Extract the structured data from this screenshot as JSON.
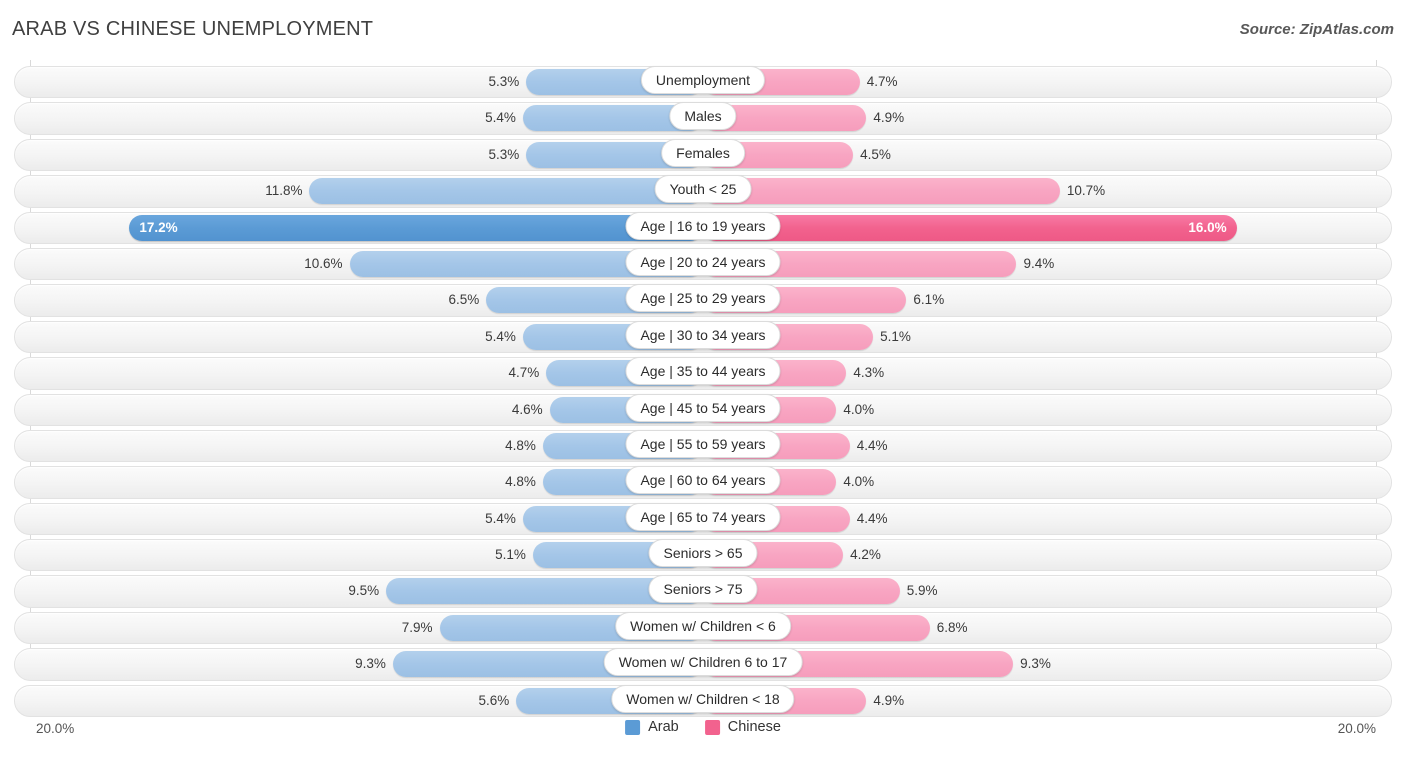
{
  "header": {
    "title": "ARAB VS CHINESE UNEMPLOYMENT",
    "source": "Source: ZipAtlas.com"
  },
  "footer": {
    "axis_min": "20.0%",
    "axis_max": "20.0%",
    "legend": [
      {
        "label": "Arab",
        "color": "#5b9bd5"
      },
      {
        "label": "Chinese",
        "color": "#f2628e"
      }
    ]
  },
  "colors": {
    "arab_normal": "#a4c6e8",
    "arab_highlight": "#5b9bd5",
    "chinese_normal": "#f8a5c2",
    "chinese_highlight": "#f2628e",
    "track": "#f4f4f4",
    "title_text": "#404040"
  },
  "chart_data": {
    "type": "bar",
    "title": "ARAB VS CHINESE UNEMPLOYMENT",
    "subtitle": "",
    "orientation": "horizontal-diverging",
    "xlabel": "",
    "ylabel": "",
    "axis_max": 20.0,
    "axis_unit": "%",
    "grid": false,
    "legend_position": "bottom-center",
    "categories": [
      "Unemployment",
      "Males",
      "Females",
      "Youth < 25",
      "Age | 16 to 19 years",
      "Age | 20 to 24 years",
      "Age | 25 to 29 years",
      "Age | 30 to 34 years",
      "Age | 35 to 44 years",
      "Age | 45 to 54 years",
      "Age | 55 to 59 years",
      "Age | 60 to 64 years",
      "Age | 65 to 74 years",
      "Seniors > 65",
      "Seniors > 75",
      "Women w/ Children < 6",
      "Women w/ Children 6 to 17",
      "Women w/ Children < 18"
    ],
    "series": [
      {
        "name": "Arab",
        "color": "#a4c6e8",
        "values": [
          5.3,
          5.4,
          5.3,
          11.8,
          17.2,
          10.6,
          6.5,
          5.4,
          4.7,
          4.6,
          4.8,
          4.8,
          5.4,
          5.1,
          9.5,
          7.9,
          9.3,
          5.6
        ]
      },
      {
        "name": "Chinese",
        "color": "#f8a5c2",
        "values": [
          4.7,
          4.9,
          4.5,
          10.7,
          16.0,
          9.4,
          6.1,
          5.1,
          4.3,
          4.0,
          4.4,
          4.0,
          4.4,
          4.2,
          5.9,
          6.8,
          9.3,
          4.9
        ]
      }
    ],
    "highlighted_category": "Age | 16 to 19 years"
  },
  "rows": [
    {
      "label": "Unemployment",
      "left": "5.3%",
      "right": "4.7%",
      "left_val": 5.3,
      "right_val": 4.7,
      "highlight": false
    },
    {
      "label": "Males",
      "left": "5.4%",
      "right": "4.9%",
      "left_val": 5.4,
      "right_val": 4.9,
      "highlight": false
    },
    {
      "label": "Females",
      "left": "5.3%",
      "right": "4.5%",
      "left_val": 5.3,
      "right_val": 4.5,
      "highlight": false
    },
    {
      "label": "Youth < 25",
      "left": "11.8%",
      "right": "10.7%",
      "left_val": 11.8,
      "right_val": 10.7,
      "highlight": false
    },
    {
      "label": "Age | 16 to 19 years",
      "left": "17.2%",
      "right": "16.0%",
      "left_val": 17.2,
      "right_val": 16.0,
      "highlight": true
    },
    {
      "label": "Age | 20 to 24 years",
      "left": "10.6%",
      "right": "9.4%",
      "left_val": 10.6,
      "right_val": 9.4,
      "highlight": false
    },
    {
      "label": "Age | 25 to 29 years",
      "left": "6.5%",
      "right": "6.1%",
      "left_val": 6.5,
      "right_val": 6.1,
      "highlight": false
    },
    {
      "label": "Age | 30 to 34 years",
      "left": "5.4%",
      "right": "5.1%",
      "left_val": 5.4,
      "right_val": 5.1,
      "highlight": false
    },
    {
      "label": "Age | 35 to 44 years",
      "left": "4.7%",
      "right": "4.3%",
      "left_val": 4.7,
      "right_val": 4.3,
      "highlight": false
    },
    {
      "label": "Age | 45 to 54 years",
      "left": "4.6%",
      "right": "4.0%",
      "left_val": 4.6,
      "right_val": 4.0,
      "highlight": false
    },
    {
      "label": "Age | 55 to 59 years",
      "left": "4.8%",
      "right": "4.4%",
      "left_val": 4.8,
      "right_val": 4.4,
      "highlight": false
    },
    {
      "label": "Age | 60 to 64 years",
      "left": "4.8%",
      "right": "4.0%",
      "left_val": 4.8,
      "right_val": 4.0,
      "highlight": false
    },
    {
      "label": "Age | 65 to 74 years",
      "left": "5.4%",
      "right": "4.4%",
      "left_val": 5.4,
      "right_val": 4.4,
      "highlight": false
    },
    {
      "label": "Seniors > 65",
      "left": "5.1%",
      "right": "4.2%",
      "left_val": 5.1,
      "right_val": 4.2,
      "highlight": false
    },
    {
      "label": "Seniors > 75",
      "left": "9.5%",
      "right": "5.9%",
      "left_val": 9.5,
      "right_val": 5.9,
      "highlight": false
    },
    {
      "label": "Women w/ Children < 6",
      "left": "7.9%",
      "right": "6.8%",
      "left_val": 7.9,
      "right_val": 6.8,
      "highlight": false
    },
    {
      "label": "Women w/ Children 6 to 17",
      "left": "9.3%",
      "right": "9.3%",
      "left_val": 9.3,
      "right_val": 9.3,
      "highlight": false
    },
    {
      "label": "Women w/ Children < 18",
      "left": "5.6%",
      "right": "4.9%",
      "left_val": 5.6,
      "right_val": 4.9,
      "highlight": false
    }
  ]
}
